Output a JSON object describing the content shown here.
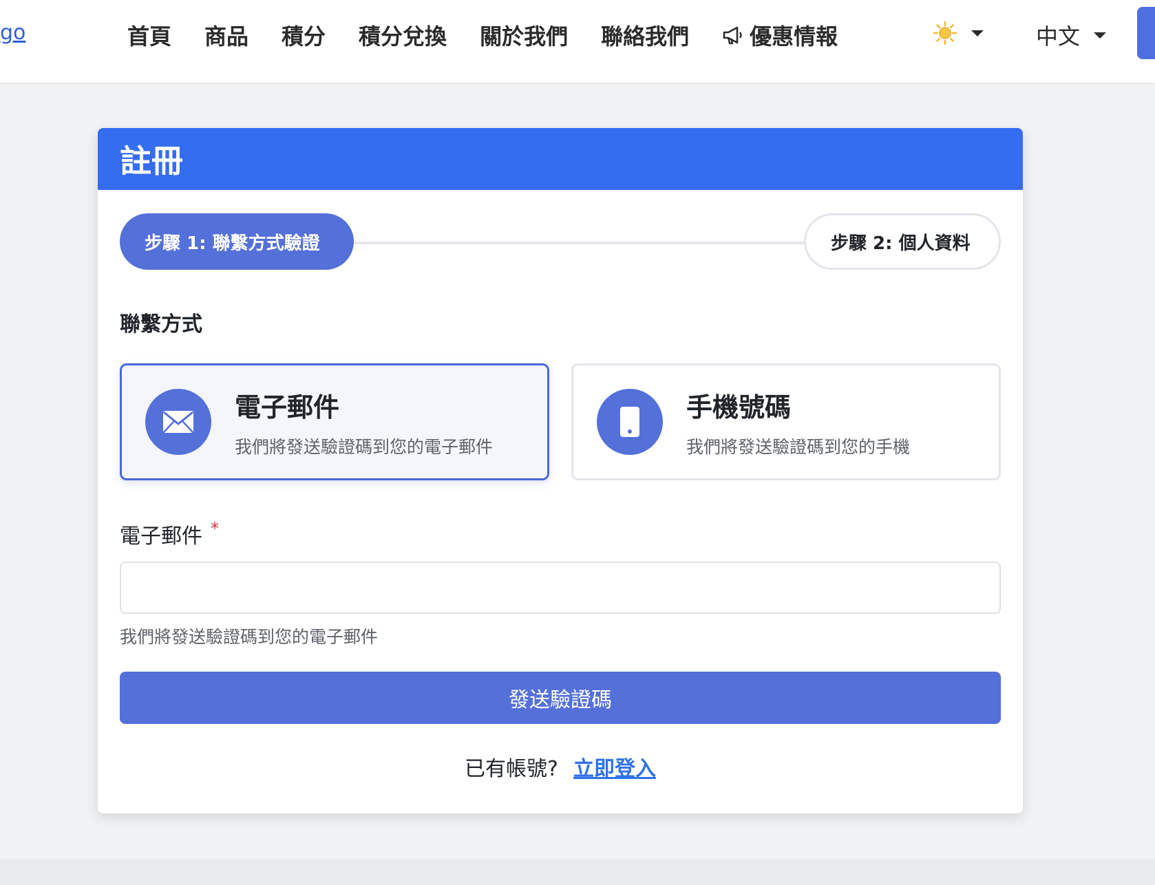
{
  "nav": {
    "logo_text": "go",
    "links": [
      "首頁",
      "商品",
      "積分",
      "積分兌換",
      "關於我們",
      "聯絡我們",
      "優惠情報"
    ],
    "promo_icon": "megaphone-icon",
    "theme_icon": "sun-icon",
    "language": "中文"
  },
  "card": {
    "title": "註冊",
    "steps": {
      "step1": "步驟 1: 聯繫方式驗證",
      "step2": "步驟 2: 個人資料"
    },
    "contact_method_label": "聯繫方式",
    "options": [
      {
        "icon": "envelope-icon",
        "title": "電子郵件",
        "desc": "我們將發送驗證碼到您的電子郵件",
        "active": true
      },
      {
        "icon": "mobile-phone-icon",
        "title": "手機號碼",
        "desc": "我們將發送驗證碼到您的手機",
        "active": false
      }
    ],
    "field": {
      "label": "電子郵件",
      "required_mark": "*",
      "value": "",
      "help": "我們將發送驗證碼到您的電子郵件"
    },
    "submit_label": "發送驗證碼",
    "login": {
      "prompt": "已有帳號?",
      "link": "立即登入"
    }
  },
  "colors": {
    "header_blue": "#356df0",
    "accent": "#5470d9",
    "link": "#2f72e8",
    "required": "#d03344"
  }
}
